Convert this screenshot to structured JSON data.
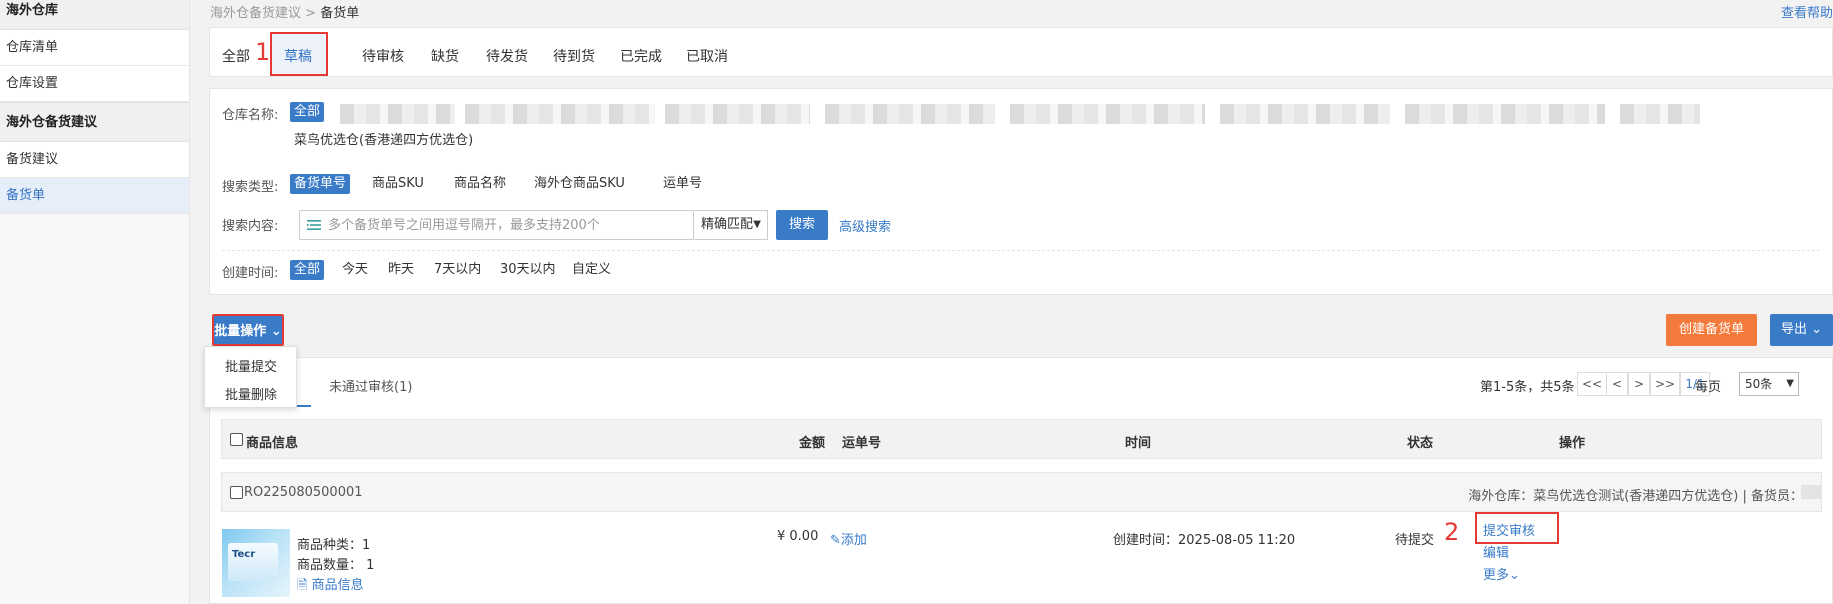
{
  "sidebar": {
    "groups": [
      {
        "title": "海外仓库",
        "items": [
          "仓库清单",
          "仓库设置"
        ]
      },
      {
        "title": "海外仓备货建议",
        "items": [
          "备货建议",
          "备货单"
        ]
      }
    ],
    "active_item": "备货单"
  },
  "breadcrumb": {
    "parent": "海外仓备货建议",
    "sep": ">",
    "current": "备货单"
  },
  "help_link": "查看帮助",
  "status_tabs": [
    "全部",
    "草稿",
    "待审核",
    "缺货",
    "待发货",
    "待到货",
    "已完成",
    "已取消"
  ],
  "active_status_tab": "草稿",
  "annotations": {
    "tab_marker": "1",
    "action_marker": "2"
  },
  "filters": {
    "warehouse_label": "仓库名称:",
    "warehouse_all": "全部",
    "warehouse_extra": "菜鸟优选仓(香港递四方优选仓)",
    "search_type_label": "搜索类型:",
    "search_types": [
      "备货单号",
      "商品SKU",
      "商品名称",
      "海外仓商品SKU",
      "运单号"
    ],
    "search_content_label": "搜索内容:",
    "search_placeholder": "多个备货单号之间用逗号隔开，最多支持200个",
    "match_mode": "精确匹配",
    "search_button": "搜索",
    "advanced_search": "高级搜索",
    "created_time_label": "创建时间:",
    "time_options": [
      "全部",
      "今天",
      "昨天",
      "7天以内",
      "30天以内",
      "自定义"
    ]
  },
  "toolbar": {
    "batch_label": "批量操作",
    "batch_menu": [
      "批量提交",
      "批量删除"
    ],
    "create_button": "创建备货单",
    "export_button": "导出"
  },
  "list": {
    "subtab_rejected": "未通过审核(1)",
    "pager_summary": "第1-5条，共5条",
    "pager_buttons": [
      "<<",
      "<",
      ">",
      ">>"
    ],
    "page_indicator": "1/1",
    "per_page_label": "每页",
    "per_page_value": "50条",
    "columns": {
      "product": "商品信息",
      "amount": "金额",
      "tracking": "运单号",
      "time": "时间",
      "status": "状态",
      "action": "操作"
    },
    "order": {
      "number": "RO225080500001",
      "meta": "海外仓库：菜鸟优选仓测试(香港递四方优选仓) | 备货员：",
      "thumb_brand": "Tecr",
      "product_kinds": "商品种类：1",
      "product_qty": "商品数量：  1",
      "product_info_link": "商品信息",
      "amount": "¥ 0.00",
      "tracking_add": "添加",
      "created_time": "创建时间：2025-08-05 11:20",
      "status": "待提交",
      "actions": [
        "提交审核",
        "编辑",
        "更多"
      ]
    }
  },
  "colors": {
    "accent_blue": "#3a7bc8",
    "highlight_red": "#e53935",
    "create_orange": "#f47a3b"
  }
}
